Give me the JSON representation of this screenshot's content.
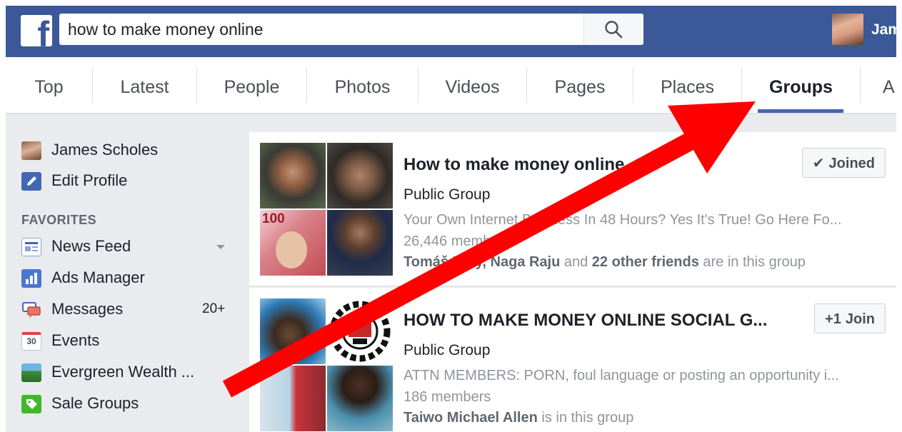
{
  "header": {
    "logo": "f",
    "search_value": "how to make money online",
    "user_name": "Jam",
    "colors": {
      "brand": "#3b5998",
      "accent": "#4267b2",
      "arrow": "#ff0000"
    }
  },
  "tabs": [
    {
      "label": "Top"
    },
    {
      "label": "Latest"
    },
    {
      "label": "People"
    },
    {
      "label": "Photos"
    },
    {
      "label": "Videos"
    },
    {
      "label": "Pages"
    },
    {
      "label": "Places"
    },
    {
      "label": "Groups",
      "active": true
    },
    {
      "label": "A"
    }
  ],
  "sidebar": {
    "user": {
      "label": "James Scholes"
    },
    "edit_profile": {
      "label": "Edit Profile"
    },
    "favorites_heading": "FAVORITES",
    "items": [
      {
        "label": "News Feed",
        "icon": "news-feed-icon"
      },
      {
        "label": "Ads Manager",
        "icon": "ads-manager-icon"
      },
      {
        "label": "Messages",
        "icon": "messages-icon",
        "count": "20+"
      },
      {
        "label": "Events",
        "icon": "calendar-icon",
        "icon_text": "30"
      },
      {
        "label": "Evergreen Wealth ...",
        "icon": "group-icon"
      },
      {
        "label": "Sale Groups",
        "icon": "tag-icon"
      }
    ]
  },
  "results": [
    {
      "title": "How to make money online",
      "type": "Public Group",
      "description": "Your Own Internet Business In 48 Hours? Yes It's True! Go Here Fo...",
      "members": "26,446 members",
      "friends_bold_1": "Tomáš Koly, Naga Raju",
      "friends_mid": " and ",
      "friends_bold_2": "22 other friends",
      "friends_tail": " are in this group",
      "button": {
        "icon": "✔",
        "label": "Joined"
      },
      "thumb_overlay_text": "100"
    },
    {
      "title": "HOW TO MAKE MONEY ONLINE SOCIAL G...",
      "type": "Public Group",
      "description": "ATTN MEMBERS: PORN, foul language or posting an opportunity i...",
      "members": "186 members",
      "friends_bold_1": "Taiwo Michael Allen",
      "friends_mid": "",
      "friends_bold_2": "",
      "friends_tail": " is in this group",
      "button": {
        "icon": "+1",
        "label": "Join"
      }
    }
  ]
}
